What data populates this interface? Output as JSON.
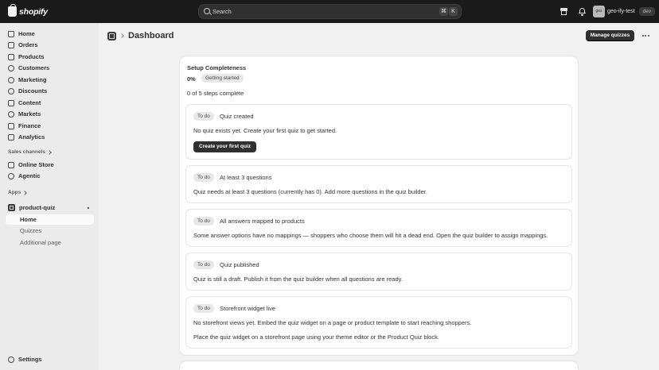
{
  "topbar": {
    "brand": "shopify",
    "search_placeholder": "Search",
    "shortcut_keys": [
      "⌘",
      "K"
    ],
    "avatar_initials": "ges",
    "account_name": "geo-ify-test",
    "account_badge": "dev"
  },
  "sidebar": {
    "items": [
      {
        "label": "Home",
        "icon": "home-icon"
      },
      {
        "label": "Orders",
        "icon": "orders-icon"
      },
      {
        "label": "Products",
        "icon": "products-icon"
      },
      {
        "label": "Customers",
        "icon": "customers-icon"
      },
      {
        "label": "Marketing",
        "icon": "marketing-icon"
      },
      {
        "label": "Discounts",
        "icon": "discounts-icon"
      },
      {
        "label": "Content",
        "icon": "content-icon"
      },
      {
        "label": "Markets",
        "icon": "markets-icon"
      },
      {
        "label": "Finance",
        "icon": "finance-icon"
      },
      {
        "label": "Analytics",
        "icon": "analytics-icon"
      }
    ],
    "sales_channels_heading": "Sales channels",
    "sales_channels": [
      {
        "label": "Online Store",
        "icon": "online-store-icon"
      },
      {
        "label": "Agentic",
        "icon": "agentic-icon"
      }
    ],
    "apps_heading": "Apps",
    "app": {
      "label": "product-quiz",
      "subitems": [
        {
          "label": "Home",
          "active": true
        },
        {
          "label": "Quizzes",
          "active": false
        },
        {
          "label": "Additional page",
          "active": false
        }
      ]
    },
    "settings_label": "Settings"
  },
  "main": {
    "title": "Dashboard",
    "manage_button": "Manage quizzes",
    "setup": {
      "title": "Setup Completeness",
      "percent": "0%",
      "status_badge": "Getting started",
      "steps_summary": "0 of 5 steps complete",
      "steps": [
        {
          "status": "To do",
          "title": "Quiz created",
          "description": "No quiz exists yet. Create your first quiz to get started.",
          "button": "Create your first quiz"
        },
        {
          "status": "To do",
          "title": "At least 3 questions",
          "description": "Quiz needs at least 3 questions (currently has 0). Add more questions in the quiz builder."
        },
        {
          "status": "To do",
          "title": "All answers mapped to products",
          "description": "Some answer options have no mappings — shoppers who choose them will hit a dead end. Open the quiz builder to assign mappings."
        },
        {
          "status": "To do",
          "title": "Quiz published",
          "description": "Quiz is still a draft. Publish it from the quiz builder when all questions are ready."
        },
        {
          "status": "To do",
          "title": "Storefront widget live",
          "description": "No storefront views yet. Embed the quiz widget on a page or product template to start reaching shoppers.",
          "description2": "Place the quiz widget on a storefront page using your theme editor or the Product Quiz block."
        }
      ]
    }
  },
  "colors": {
    "topbar_bg": "#1a1a1a",
    "sidebar_bg": "#ebebeb",
    "page_bg": "#f1f1f1",
    "primary_button": "#303030"
  }
}
